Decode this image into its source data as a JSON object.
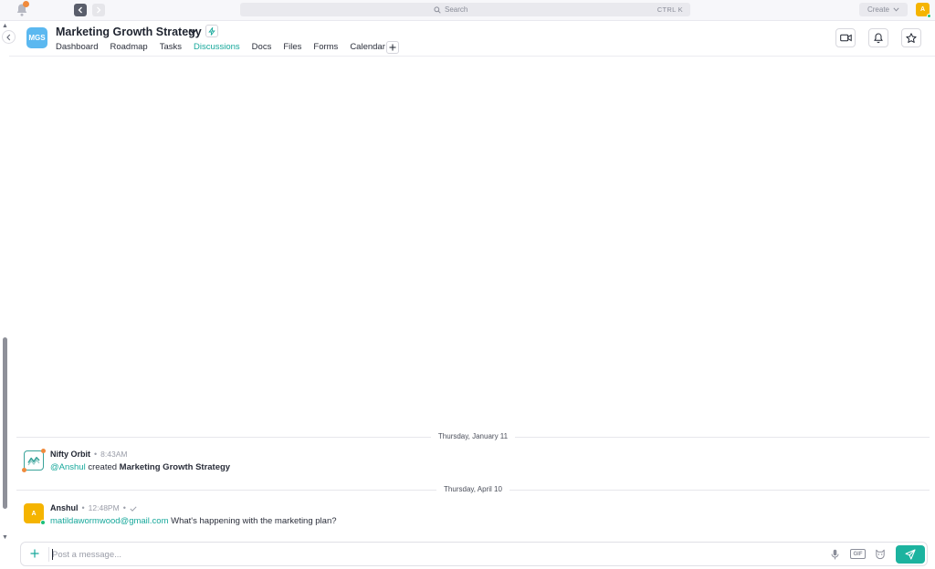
{
  "topbar": {
    "search_label": "Search",
    "search_shortcut": "CTRL K",
    "create_label": "Create",
    "user_initial": "A"
  },
  "project": {
    "initials": "MGS",
    "title": "Marketing Growth Strategy",
    "tabs": [
      {
        "label": "Dashboard",
        "active": false
      },
      {
        "label": "Roadmap",
        "active": false
      },
      {
        "label": "Tasks",
        "active": false
      },
      {
        "label": "Discussions",
        "active": true
      },
      {
        "label": "Docs",
        "active": false
      },
      {
        "label": "Files",
        "active": false
      },
      {
        "label": "Forms",
        "active": false
      },
      {
        "label": "Calendar",
        "active": false
      }
    ]
  },
  "feed": {
    "dividers": [
      "Thursday, January 11",
      "Thursday, April 10"
    ],
    "messages": [
      {
        "author": "Nifty Orbit",
        "time": "8:43AM",
        "mention": "@Anshul",
        "text": " created ",
        "bold": "Marketing Growth Strategy"
      },
      {
        "author": "Anshul",
        "avatar": "A",
        "time": "12:48PM",
        "mention": "matildawormwood@gmail.com",
        "text": " What's happening with the marketing plan?"
      }
    ]
  },
  "composer": {
    "placeholder": "Post a message...",
    "gif_label": "GIF"
  },
  "colors": {
    "accent": "#17a89b",
    "send": "#1cb39f",
    "project_icon": "#5bb8f0",
    "user_avatar": "#f5b400",
    "online": "#1bbf7a"
  }
}
